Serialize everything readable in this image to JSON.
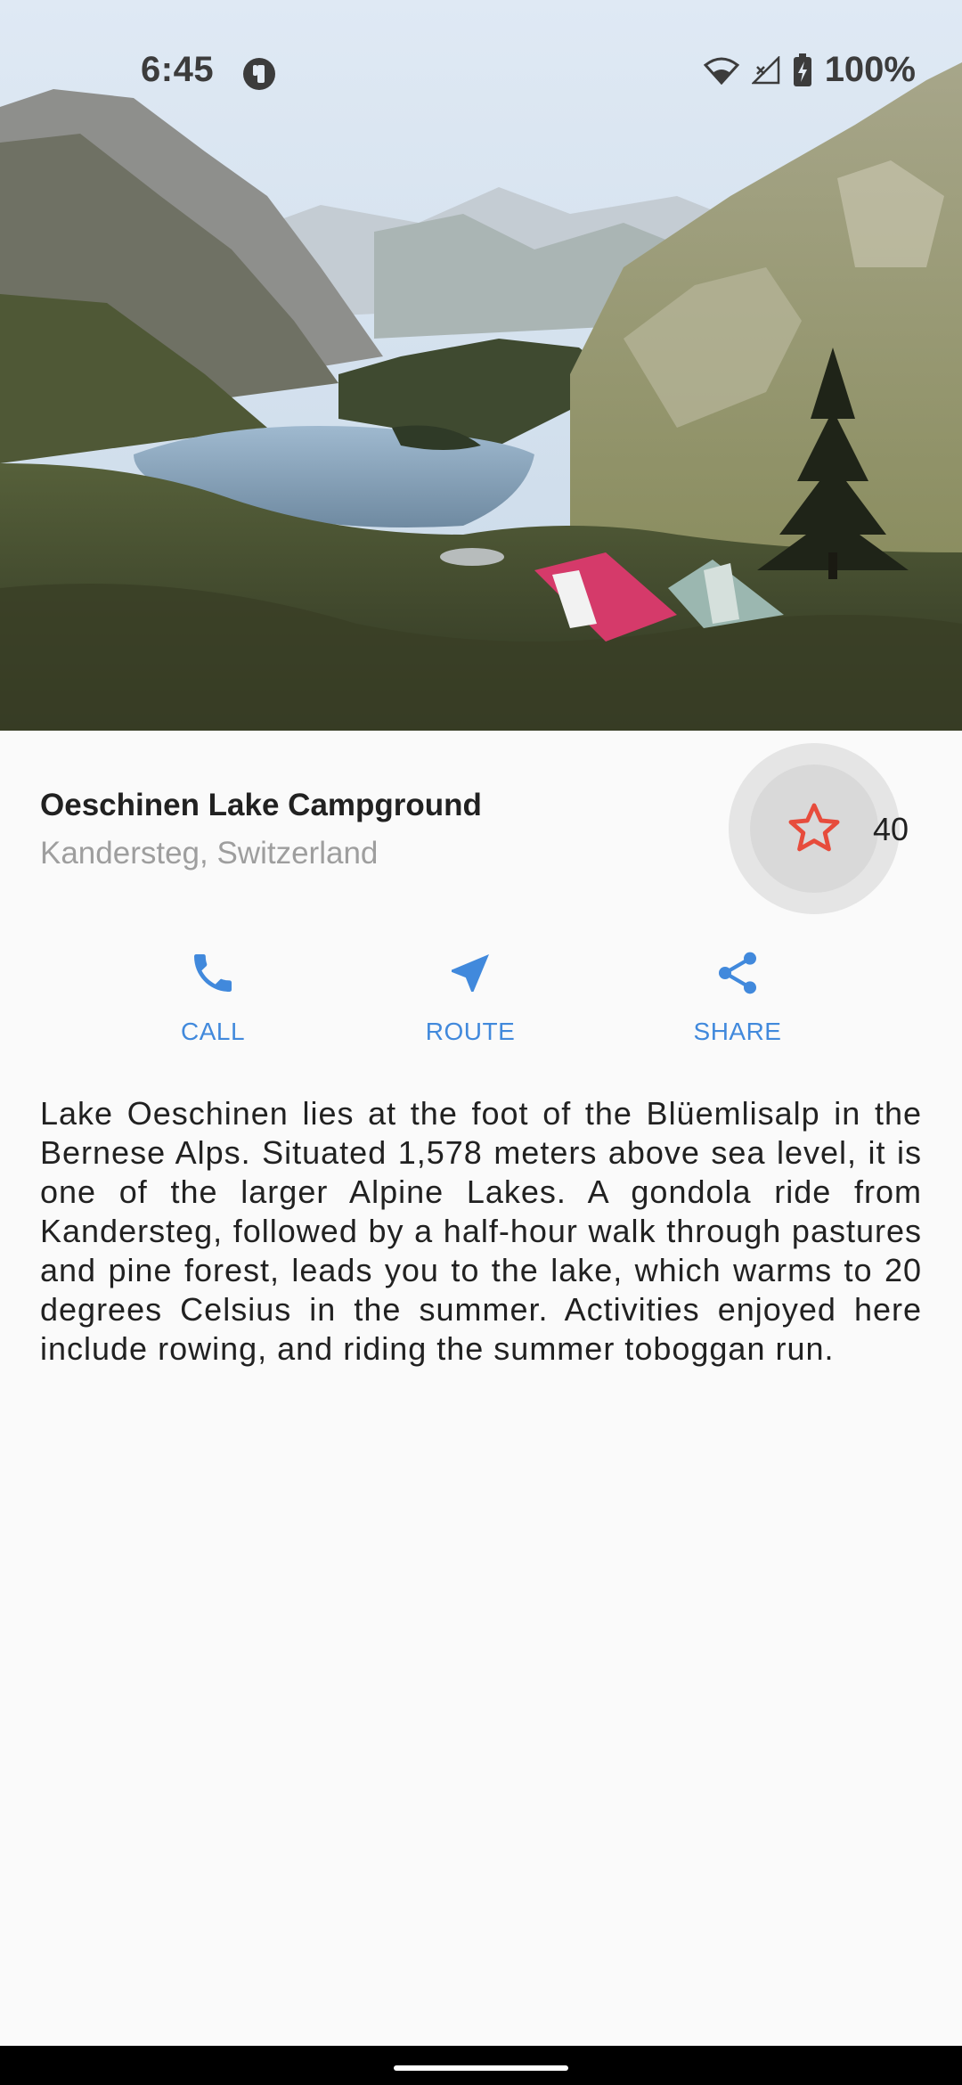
{
  "status_bar": {
    "time": "6:45",
    "battery": "100%"
  },
  "hero": {
    "scene": "mountain-lake-campground-photo"
  },
  "place": {
    "title": "Oeschinen Lake Campground",
    "location": "Kandersteg, Switzerland"
  },
  "favorite": {
    "count": "40",
    "icon": "star-outline-icon",
    "color": "#e74c3c"
  },
  "actions": [
    {
      "label": "CALL",
      "icon": "phone-icon"
    },
    {
      "label": "ROUTE",
      "icon": "navigation-arrow-icon"
    },
    {
      "label": "SHARE",
      "icon": "share-icon"
    }
  ],
  "accent_color": "#4189dc",
  "description": "Lake Oeschinen lies at the foot of the Blüemlisalp in the Bernese Alps. Situated 1,578 meters above sea level, it is one of the larger Alpine Lakes. A gondola ride from Kandersteg, followed by a half-hour walk through pastures and pine forest, leads you to the lake, which warms to 20 degrees Celsius in the summer. Activities enjoyed here include rowing, and riding the summer toboggan run."
}
